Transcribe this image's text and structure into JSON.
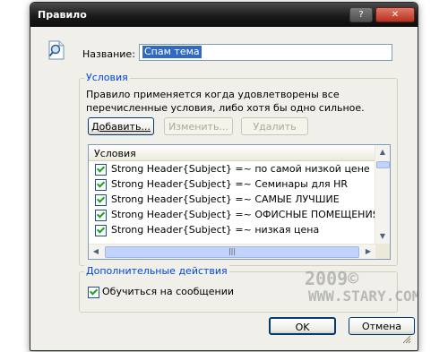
{
  "window": {
    "title": "Правило",
    "help_glyph": "?",
    "close_glyph": "✕"
  },
  "name_field": {
    "label": "Название:",
    "value": "Спам тема"
  },
  "conditions": {
    "legend": "Условия",
    "description": "Правило применяется когда удовлетворены все перечисленные условия, либо хотя бы одно сильное.",
    "buttons": {
      "add": "Добавить...",
      "edit": "Изменить...",
      "delete": "Удалить"
    },
    "column_header": "Условия",
    "rows": [
      {
        "checked": true,
        "text": "Strong Header{Subject} =~ по самой низкой цене"
      },
      {
        "checked": true,
        "text": "Strong Header{Subject} =~ Семинары для HR"
      },
      {
        "checked": true,
        "text": "Strong Header{Subject} =~ САМЫЕ ЛУЧШИЕ"
      },
      {
        "checked": true,
        "text": "Strong Header{Subject} =~ ОФИСНЫЕ ПОМЕЩЕНИЯ"
      },
      {
        "checked": true,
        "text": "Strong Header{Subject} =~ низкая цена"
      }
    ]
  },
  "extra_actions": {
    "legend": "Дополнительные действия",
    "learn_checkbox": {
      "checked": true,
      "label": "Обучиться на сообщении"
    }
  },
  "footer": {
    "ok": "OK",
    "cancel": "Отмена"
  },
  "watermark": {
    "line1": "2009©",
    "line2": "WWW.STARY.COM"
  },
  "colors": {
    "accent": "#0046d5",
    "selection": "#316ac5"
  },
  "icons": [
    "rule-search-icon",
    "help-icon",
    "close-icon",
    "scroll-up-icon",
    "scroll-down-icon",
    "scroll-left-icon",
    "scroll-right-icon",
    "resize-grip-icon"
  ]
}
